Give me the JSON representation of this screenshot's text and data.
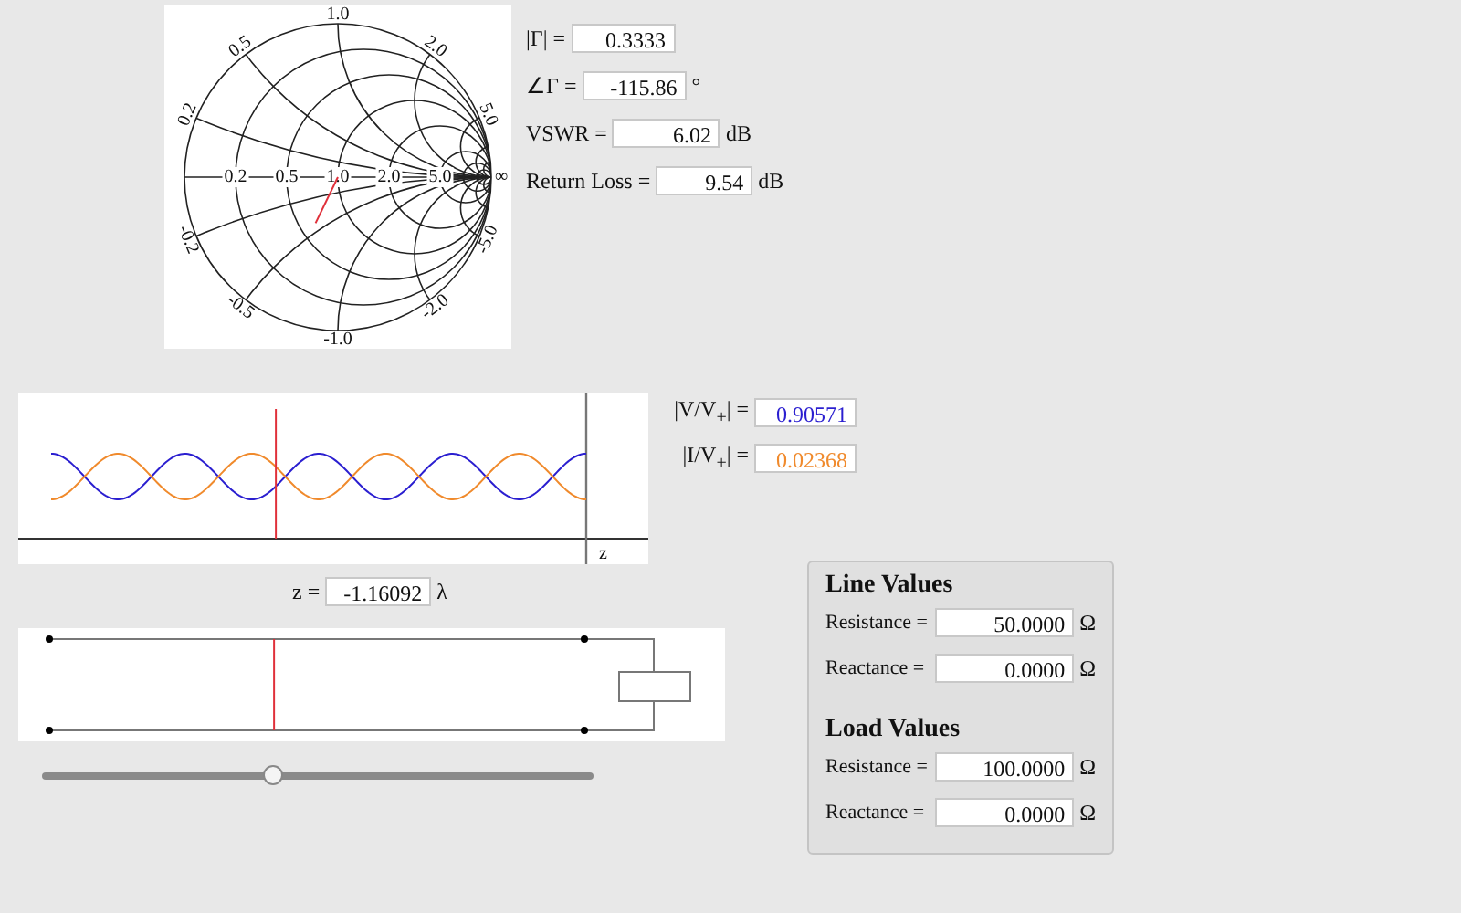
{
  "smith_chart": {
    "resistance_labels": [
      "0.2",
      "0.5",
      "1.0",
      "2.0",
      "5.0",
      "∞"
    ],
    "reactance_labels": [
      "1.0",
      "-1.0",
      "0.5",
      "2.0",
      "0.2",
      "5.0",
      "-0.2",
      "-5.0",
      "-0.5",
      "-2.0"
    ]
  },
  "reflection_readouts": [
    {
      "label": "|Γ| =",
      "value": "0.3333"
    },
    {
      "label": "∠Γ =",
      "value": "-115.86",
      "unit": "°"
    },
    {
      "label": "VSWR =",
      "value": "6.02",
      "unit": "dB"
    },
    {
      "label": "Return Loss =",
      "value": "9.54",
      "unit": "dB"
    }
  ],
  "wave_plot": {
    "axis_label": "z"
  },
  "wave_readouts": [
    {
      "label": "|V/V$_{+}$| =",
      "value": "0.90571",
      "color": "#2b1fd0"
    },
    {
      "label": "|I/V$_{+}$| =",
      "value": "0.02368",
      "color": "#f08a2c"
    }
  ],
  "position": {
    "label": "z =",
    "value": "-1.16092",
    "unit": "λ"
  },
  "position_slider": {
    "level": 0.42
  },
  "values_panel": [
    {
      "title": "Line Values",
      "fields": [
        {
          "label": "Resistance =",
          "value": "50.0000",
          "unit": "Ω"
        },
        {
          "label": "Reactance =",
          "value": "0.0000",
          "unit": "Ω"
        }
      ]
    },
    {
      "title": "Load Values",
      "fields": [
        {
          "label": "Resistance =",
          "value": "100.0000",
          "unit": "Ω"
        },
        {
          "label": "Reactance =",
          "value": "0.0000",
          "unit": "Ω"
        }
      ]
    }
  ]
}
